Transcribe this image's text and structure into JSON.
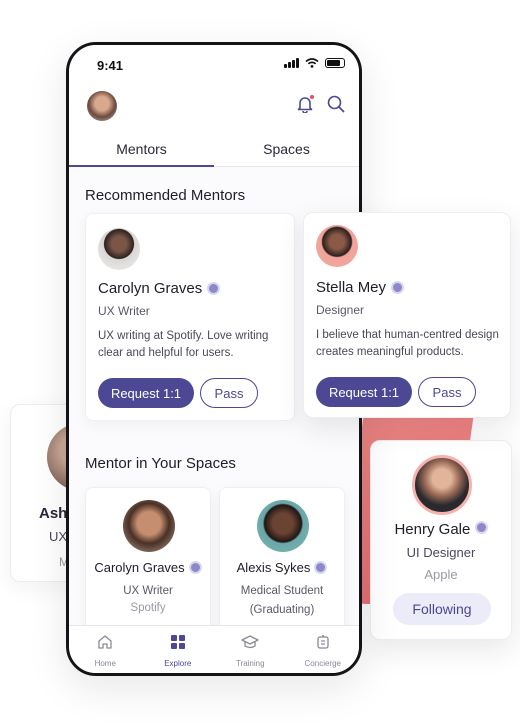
{
  "status": {
    "time": "9:41"
  },
  "tabs": [
    "Mentors",
    "Spaces"
  ],
  "recommended": {
    "title": "Recommended Mentors",
    "cards": [
      {
        "name": "Carolyn Graves",
        "role": "UX Writer",
        "bio": "UX writing at Spotify. Love writing clear and helpful for users.",
        "request": "Request 1:1",
        "pass": "Pass"
      },
      {
        "name": "Stella Mey",
        "role": "Designer",
        "bio": "I believe that human-centred design creates meaningful products.",
        "request": "Request 1:1",
        "pass": "Pass"
      }
    ]
  },
  "spaces": {
    "title": "Mentor in Your Spaces",
    "cards": [
      {
        "name": "Carolyn Graves",
        "role": "UX Writer",
        "org": "Spotify"
      },
      {
        "name": "Alexis Sykes",
        "role": "Medical Student (Graduating)"
      }
    ]
  },
  "ghost_card": {
    "name": "Ash",
    "role": "UX",
    "org": "M"
  },
  "henry_card": {
    "name": "Henry Gale",
    "role": "UI Designer",
    "org": "Apple",
    "follow": "Following"
  },
  "nav": [
    "Home",
    "Explore",
    "Training",
    "Concierge"
  ],
  "colors": {
    "accent": "#4c4894",
    "notification": "#e8505b",
    "blob": "#ec7a7c"
  }
}
